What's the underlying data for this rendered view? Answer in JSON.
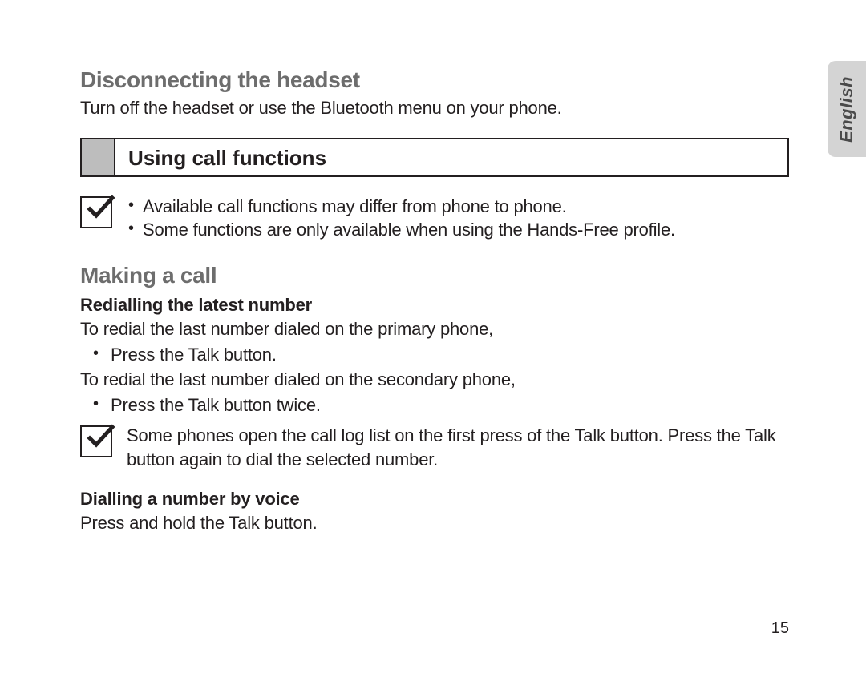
{
  "lang_tab": "English",
  "section1": {
    "heading": "Disconnecting the headset",
    "body": "Turn off the headset or use the Bluetooth menu on your phone."
  },
  "box_heading": "Using call functions",
  "note1": {
    "items": [
      "Available call functions may differ from phone to phone.",
      "Some functions are only available when using the Hands-Free profile."
    ]
  },
  "section2": {
    "heading": "Making a call",
    "sub1_heading": "Redialling the latest number",
    "sub1_p1": "To redial the last number dialed on the primary phone,",
    "sub1_list1": [
      "Press the Talk button."
    ],
    "sub1_p2": "To redial the last number dialed on the secondary phone,",
    "sub1_list2": [
      "Press the Talk button twice."
    ],
    "note2": "Some phones open the call log list on the first press of the Talk button. Press the Talk button again to dial the selected number.",
    "sub2_heading": "Dialling a number by voice",
    "sub2_p1": "Press and hold the Talk button."
  },
  "page_number": "15"
}
